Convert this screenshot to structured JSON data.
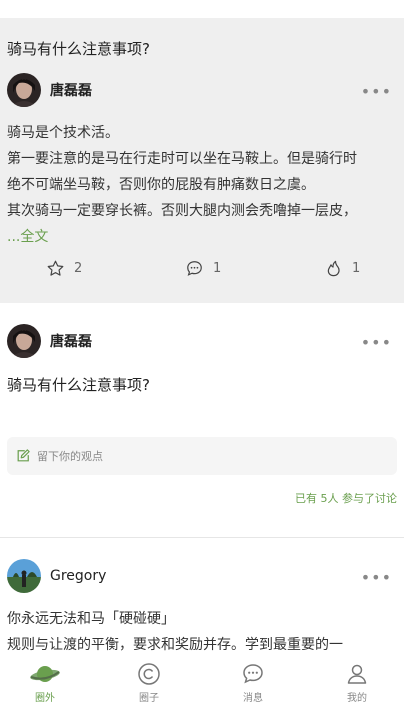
{
  "post1": {
    "question": "骑马有什么注意事项?",
    "author": "唐磊磊",
    "more": "•••",
    "lines": [
      "骑马是个技术活。",
      "第一要注意的是马在行走时可以坐在马鞍上。但是骑行时",
      "绝不可端坐马鞍，否则你的屁股有肿痛数日之虞。",
      "其次骑马一定要穿长裤。否则大腿内测会秃噜掉一层皮，"
    ],
    "fulltext": "...全文",
    "likes": "2",
    "comments": "1",
    "hot": "1"
  },
  "post2": {
    "author": "唐磊磊",
    "more": "•••",
    "question": "骑马有什么注意事项?",
    "placeholder": "留下你的观点",
    "joined": "已有 5人 参与了讨论"
  },
  "post3": {
    "author": "Gregory",
    "more": "•••",
    "lines": [
      "你永远无法和马「硬碰硬」",
      "规则与让渡的平衡，要求和奖励并存。学到最重要的一"
    ]
  },
  "tabs": [
    {
      "label": "圈外",
      "icon": "planet-icon",
      "active": true
    },
    {
      "label": "圈子",
      "icon": "circle-c-icon",
      "active": false
    },
    {
      "label": "消息",
      "icon": "chat-bubble-icon",
      "active": false
    },
    {
      "label": "我的",
      "icon": "person-icon",
      "active": false
    }
  ],
  "colors": {
    "accent": "#6a9f4e",
    "card_bg": "#efefef"
  }
}
